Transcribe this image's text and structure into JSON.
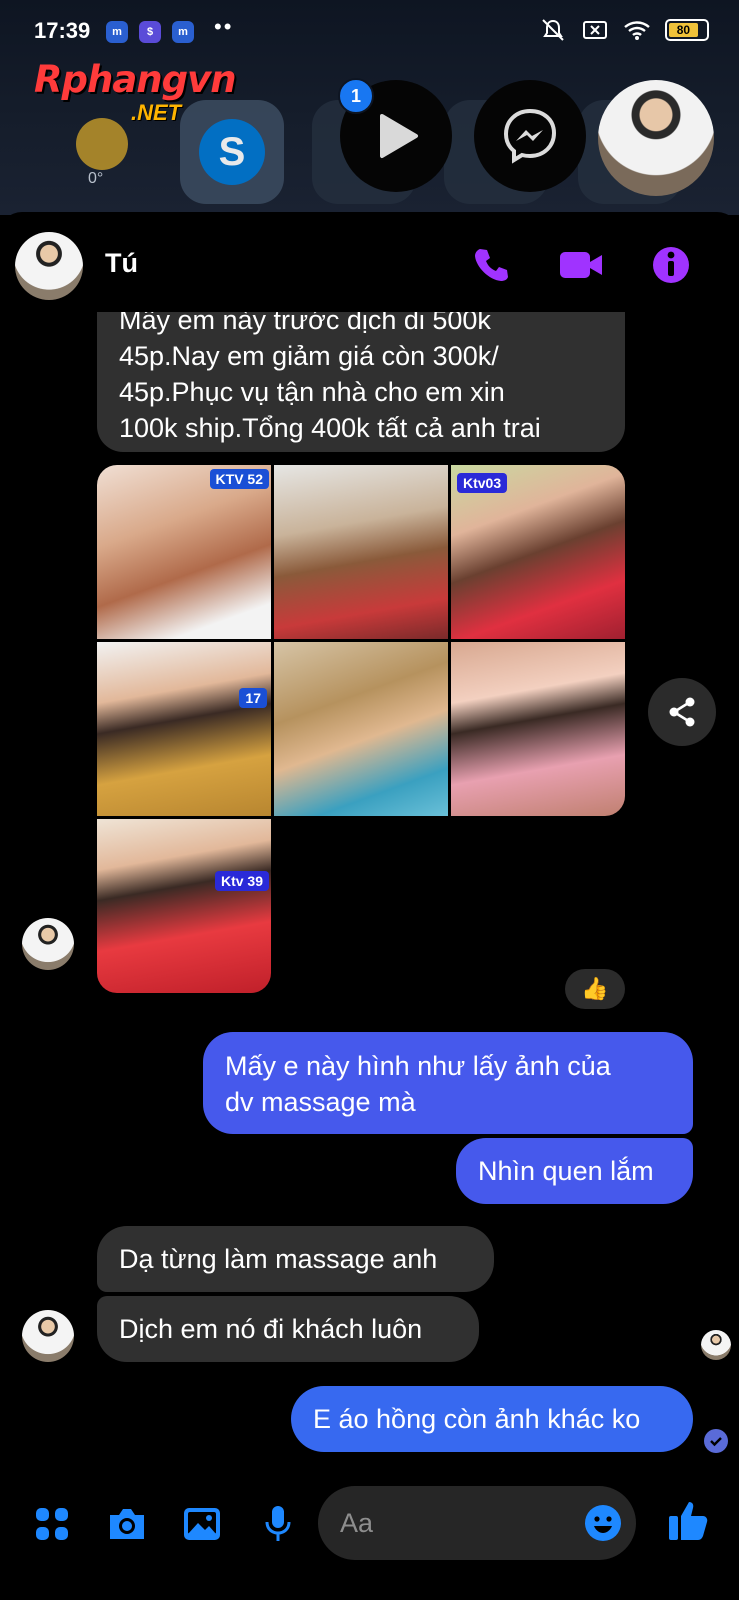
{
  "status_bar": {
    "time": "17:39",
    "notification_apps": [
      "messenger-lite-icon",
      "shield-dollar-icon",
      "messenger-lite-icon"
    ],
    "app_glyphs": [
      "m",
      "$",
      "m"
    ],
    "overflow": "••",
    "icons": [
      "mute-bell-icon",
      "sim-x-icon",
      "wifi-icon"
    ],
    "battery": "80"
  },
  "watermark": {
    "brand": "Rphangvn",
    "suffix": ".NET"
  },
  "home_strip": {
    "weather_temp": "0°",
    "skype_glyph": "S",
    "chat_heads": [
      {
        "name": "play-chat-head",
        "icon": "play-icon",
        "badge": "1"
      },
      {
        "name": "messenger-chat-head",
        "icon": "messenger-icon"
      },
      {
        "name": "contact-chat-head",
        "icon": "avatar"
      }
    ]
  },
  "header": {
    "name": "Tú",
    "actions": [
      "phone-icon",
      "video-icon",
      "info-icon"
    ],
    "accent_color": "#a033ff"
  },
  "messages": {
    "incoming_long": [
      "Mấy em này trước dịch di 500k",
      "45p.Nay em giảm giá còn 300k/",
      "45p.Phục vụ tận nhà cho em xin",
      "100k ship.Tổng 400k tất cả anh trai"
    ],
    "photo_tags": [
      "KTV 52",
      "Ktv03",
      "17",
      "Ktv 39"
    ],
    "reaction": "👍",
    "outgoing_1": [
      "Mấy e này hình như lấy ảnh của",
      "dv massage mà"
    ],
    "outgoing_2": "Nhìn quen lắm",
    "incoming_1": "Dạ từng làm massage anh",
    "incoming_2": "Dịch em nó đi khách luôn",
    "outgoing_3": "E áo hồng còn ảnh khác ko"
  },
  "composer": {
    "placeholder": "Aa",
    "buttons": [
      "menu-dots-icon",
      "camera-icon",
      "gallery-icon",
      "mic-icon",
      "emoji-icon",
      "thumbs-up-icon"
    ],
    "accent_color": "#1e88ff"
  },
  "colors": {
    "incoming_bubble": "#303030",
    "outgoing_bubble": "#4659ec",
    "background": "#000000"
  }
}
